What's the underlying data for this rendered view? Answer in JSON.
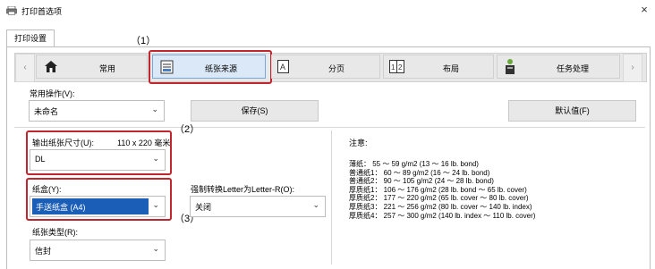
{
  "window": {
    "title": "打印首选项",
    "close_glyph": "×"
  },
  "tabs": [
    {
      "label": "打印设置"
    }
  ],
  "ribbon": {
    "prev_glyph": "‹",
    "next_glyph": "›",
    "items": [
      {
        "label": "常用",
        "icon": "home-icon"
      },
      {
        "label": "纸张来源",
        "icon": "paper-tray-icon",
        "selected": true
      },
      {
        "label": "分页",
        "icon": "page-a-icon"
      },
      {
        "label": "布局",
        "icon": "layout-1-2-icon"
      },
      {
        "label": "任务处理",
        "icon": "stapler-icon"
      }
    ]
  },
  "callouts": {
    "one": "（1）",
    "two": "（2）",
    "three": "（3）"
  },
  "common": {
    "label": "常用操作(V):",
    "value": "未命名",
    "save_label": "保存(S)",
    "default_label": "默认值(F)"
  },
  "output_size": {
    "label": "输出纸张尺寸(U):",
    "dims": "110 x 220 毫米",
    "value": "DL"
  },
  "tray": {
    "label": "纸盒(Y):",
    "value": "手送纸盒 (A4)"
  },
  "force_convert": {
    "label": "强制转换Letter为Letter-R(O):",
    "value": "关闭"
  },
  "paper_type": {
    "label": "纸张类型(R):",
    "value": "信封"
  },
  "notes": {
    "title": "注意:",
    "lines": [
      "薄纸： 55 ～ 59 g/m2 (13 ～ 16 lb. bond)",
      "普通纸1： 60 ～ 89 g/m2 (16 ～ 24 lb. bond)",
      "普通纸2： 90 ～ 105 g/m2 (24 ～ 28 lb. bond)",
      "厚质纸1： 106 ～ 176 g/m2 (28 lb. bond ～ 65 lb. cover)",
      "厚质纸2： 177 ～ 220 g/m2 (65 lb. cover ～ 80 lb. cover)",
      "厚质纸3： 221 ～ 256 g/m2 (80 lb. cover ～ 140 lb. index)",
      "厚质纸4： 257 ～ 300 g/m2 (140 lb. index ～ 110 lb. cover)"
    ]
  },
  "colors": {
    "accent_red": "#c0262e",
    "selection_blue": "#1a5eb8",
    "ribbon_selected": "#dbe8f7"
  }
}
